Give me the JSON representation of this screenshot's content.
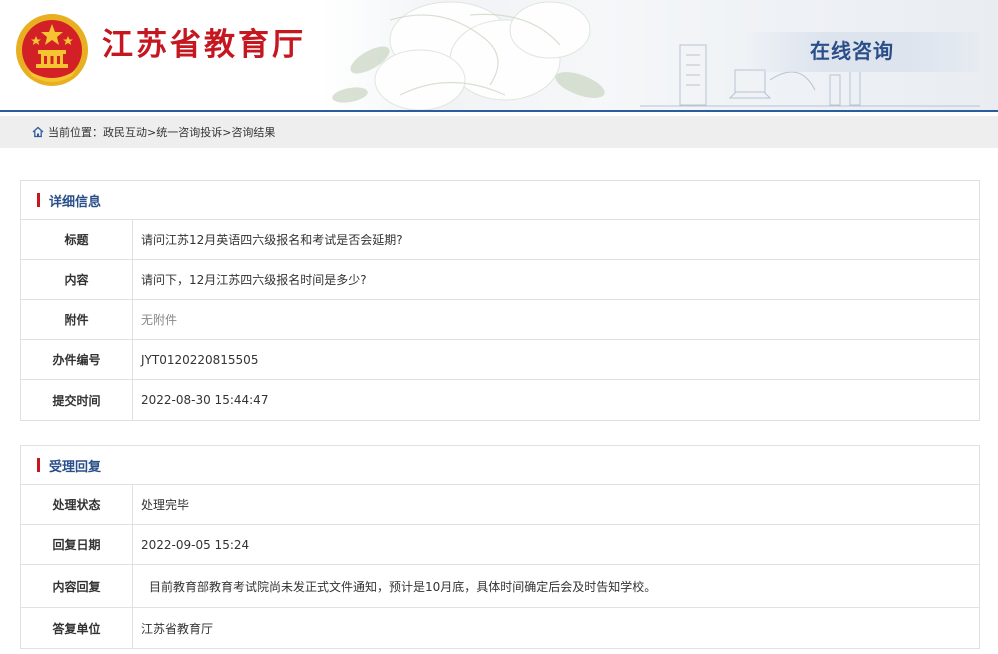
{
  "header": {
    "site_title": "江苏省教育厅",
    "section_title": "在线咨询",
    "colors": {
      "brand_red": "#c4171f",
      "brand_blue": "#2b5c9e"
    }
  },
  "breadcrumb": {
    "icon": "home-icon",
    "prefix": "当前位置：",
    "items": [
      "政民互动>",
      "统一咨询投诉>",
      "咨询结果"
    ]
  },
  "details": {
    "title": "详细信息",
    "rows": [
      {
        "label": "标题",
        "value": "请问江苏12月英语四六级报名和考试是否会延期?"
      },
      {
        "label": "内容",
        "value": "请问下，12月江苏四六级报名时间是多少?"
      },
      {
        "label": "附件",
        "value": "无附件"
      },
      {
        "label": "办件编号",
        "value": "JYT0120220815505"
      },
      {
        "label": "提交时间",
        "value": "2022-08-30 15:44:47"
      }
    ]
  },
  "reply": {
    "title": "受理回复",
    "rows": [
      {
        "label": "处理状态",
        "value": "处理完毕"
      },
      {
        "label": "回复日期",
        "value": "2022-09-05 15:24"
      },
      {
        "label": "内容回复",
        "value": "目前教育部教育考试院尚未发正式文件通知，预计是10月底，具体时间确定后会及时告知学校。"
      },
      {
        "label": "答复单位",
        "value": "江苏省教育厅"
      }
    ]
  }
}
